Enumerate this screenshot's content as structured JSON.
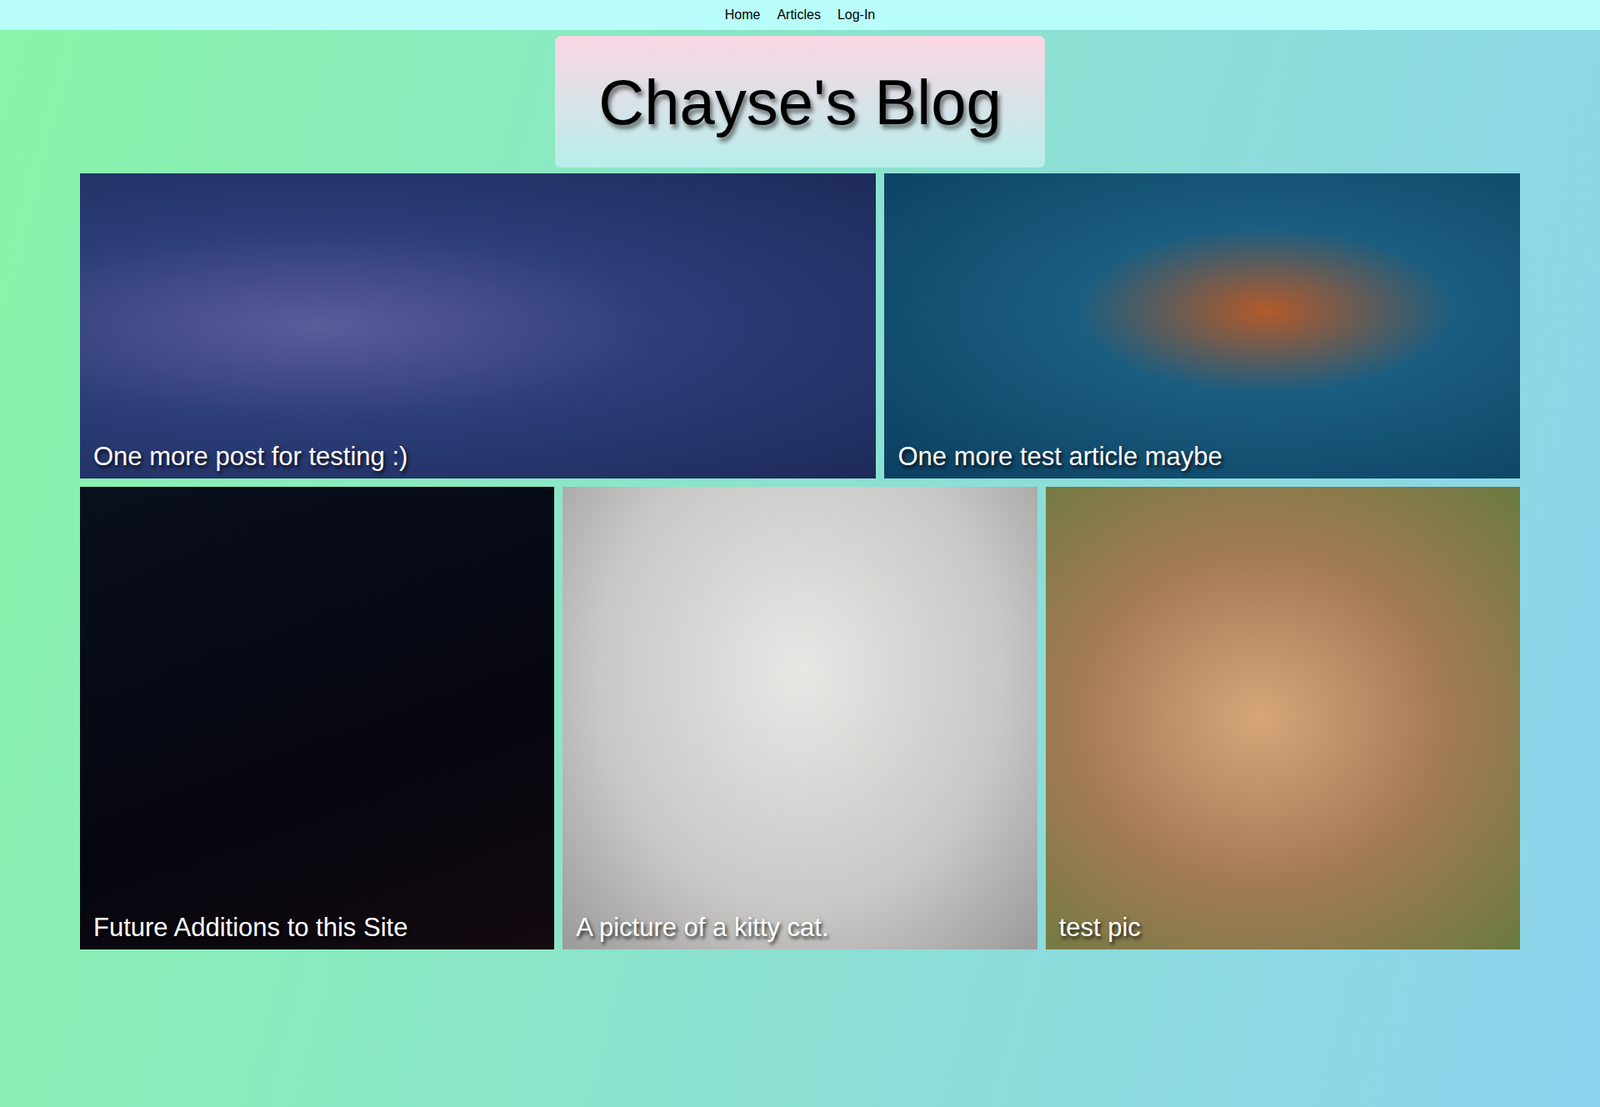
{
  "nav": {
    "links": [
      "Home",
      "Articles",
      "Log-In"
    ]
  },
  "header": {
    "title": "Chayse's Blog"
  },
  "posts": {
    "rows": [
      [
        {
          "title": "One more post for testing :)"
        },
        {
          "title": "One more test article maybe"
        }
      ],
      [
        {
          "title": "Future Additions to this Site"
        },
        {
          "title": "A picture of a kitty cat."
        },
        {
          "title": "test pic"
        }
      ]
    ]
  }
}
